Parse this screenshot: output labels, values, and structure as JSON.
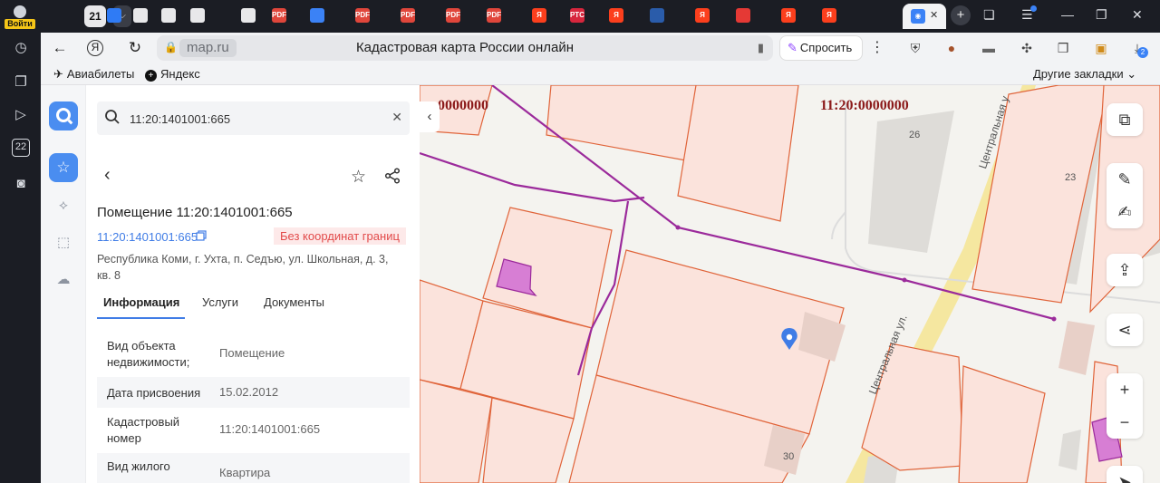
{
  "browser": {
    "login_label": "Войти",
    "tab_count": "21",
    "address_domain": "map.ru",
    "page_title": "Кадастровая карта России онлайн",
    "ask_label": "Спросить",
    "extension_badge": "2",
    "tabs": [
      {
        "icon": "square-icon",
        "color": "#2f7bf5",
        "text": ""
      },
      {
        "icon": "page-icon",
        "color": "#e8e8ea",
        "text": ""
      },
      {
        "icon": "table-icon",
        "color": "#e8e8ea",
        "text": ""
      },
      {
        "icon": "table-icon",
        "color": "#e8e8ea",
        "text": ""
      },
      {
        "icon": "page-icon",
        "color": "#e8e8ea",
        "text": ""
      },
      {
        "icon": "pdf-icon",
        "color": "#e0463b",
        "text": "PDF"
      },
      {
        "icon": "mail-icon",
        "color": "#3b82f6",
        "text": ""
      },
      {
        "icon": "pdf-icon",
        "color": "#e0463b",
        "text": "PDF"
      },
      {
        "icon": "pdf-icon",
        "color": "#e0463b",
        "text": "PDF"
      },
      {
        "icon": "pdf-icon",
        "color": "#e0463b",
        "text": "PDF"
      },
      {
        "icon": "pdf-icon",
        "color": "#e0463b",
        "text": "PDF"
      },
      {
        "icon": "yandex-icon",
        "color": "#fc3f1d",
        "text": "Я"
      },
      {
        "icon": "rts-icon",
        "color": "#d7263d",
        "text": "РТС"
      },
      {
        "icon": "yandex-icon",
        "color": "#fc3f1d",
        "text": "Я"
      },
      {
        "icon": "emblem-icon",
        "color": "#2a5caa",
        "text": ""
      },
      {
        "icon": "yandex-icon",
        "color": "#fc3f1d",
        "text": "Я"
      },
      {
        "icon": "pin-icon",
        "color": "#e53935",
        "text": ""
      },
      {
        "icon": "yandex-icon",
        "color": "#fc3f1d",
        "text": "Я"
      },
      {
        "icon": "yandex-icon",
        "color": "#fc3f1d",
        "text": "Я"
      }
    ]
  },
  "bookmarks": {
    "item1": "Авиабилеты",
    "item2": "Яндекс",
    "other": "Другие закладки"
  },
  "search": {
    "value": "11:20:1401001:665"
  },
  "object": {
    "title": "Помещение 11:20:1401001:665",
    "cadastral_link": "11:20:1401001:665",
    "badge": "Без координат границ",
    "address": "Республика Коми, г. Ухта, п. Седъю, ул. Школьная, д. 3, кв. 8"
  },
  "tabs": {
    "info": "Информация",
    "services": "Услуги",
    "documents": "Документы"
  },
  "info_rows": [
    {
      "key": "Вид объекта недвижимости;",
      "value": "Помещение"
    },
    {
      "key": "Дата присвоения",
      "value": "15.02.2012"
    },
    {
      "key": "Кадастровый номер",
      "value": "11:20:1401001:665"
    },
    {
      "key": "Вид жилого",
      "value": "Квартира"
    }
  ],
  "map": {
    "label_left": "0000000",
    "label_main": "11:20:0000000",
    "street_top": "Центральная у",
    "street_bottom": "Центральная ул.",
    "building_26": "26",
    "building_23": "23",
    "building_30": "30",
    "colors": {
      "parcel_fill": "#fbe3dc",
      "parcel_stroke": "#e0643a",
      "selected_fill": "#d77ed4",
      "boundary": "#9b2a9b",
      "road": "#f5e7a0",
      "marker": "#3f7ce6"
    }
  }
}
